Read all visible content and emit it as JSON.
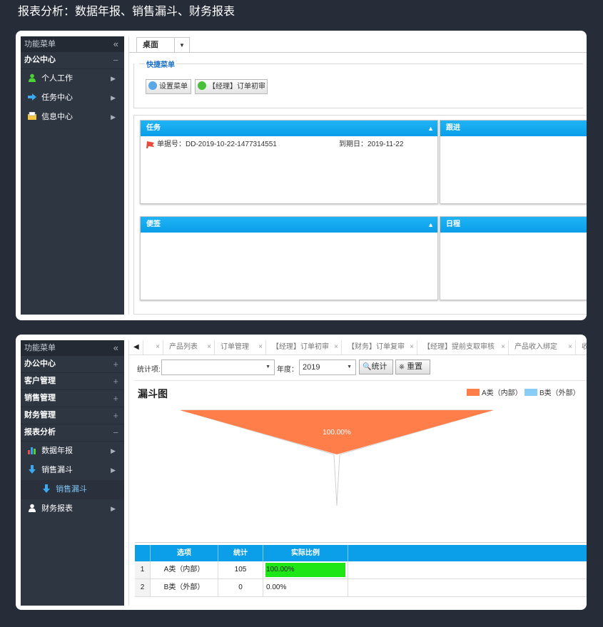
{
  "page_title": "报表分析：数据年报、销售漏斗、财务报表",
  "screen1": {
    "sidebar": {
      "header": "功能菜单",
      "collapse_glyph": "«",
      "group": {
        "label": "办公中心",
        "toggle": "−"
      },
      "items": [
        {
          "label": "个人工作",
          "icon": "user-icon"
        },
        {
          "label": "任务中心",
          "icon": "arrow-right-icon"
        },
        {
          "label": "信息中心",
          "icon": "message-icon"
        }
      ]
    },
    "tabs": {
      "desk": "桌面",
      "dropdown_glyph": "▼"
    },
    "quick_menu": {
      "legend": "快捷菜单",
      "buttons": [
        {
          "label": "设置菜单"
        },
        {
          "label": "【经理】订单初审"
        }
      ]
    },
    "panels": {
      "task": {
        "title": "任务",
        "row": {
          "order_no": "单据号：DD-2019-10-22-1477314551",
          "due": "到期日：2019-11-22"
        }
      },
      "follow": {
        "title": "跟进"
      },
      "note": {
        "title": "便签"
      },
      "schedule": {
        "title": "日程"
      }
    }
  },
  "screen2": {
    "sidebar": {
      "header": "功能菜单",
      "collapse_glyph": "«",
      "groups": [
        {
          "label": "办公中心",
          "toggle": "+"
        },
        {
          "label": "客户管理",
          "toggle": "+"
        },
        {
          "label": "销售管理",
          "toggle": "+"
        },
        {
          "label": "财务管理",
          "toggle": "+"
        },
        {
          "label": "报表分析",
          "toggle": "−"
        }
      ],
      "items": [
        {
          "label": "数据年报",
          "icon": "bar-chart-icon"
        },
        {
          "label": "销售漏斗",
          "icon": "arrow-down-icon"
        }
      ],
      "sub_item": {
        "label": "销售漏斗",
        "icon": "arrow-down-icon"
      },
      "last_item": {
        "label": "财务报表",
        "icon": "user-icon"
      }
    },
    "tabs": [
      {
        "label": "产品列表"
      },
      {
        "label": "订单管理"
      },
      {
        "label": "【经理】订单初审"
      },
      {
        "label": "【财务】订单复审"
      },
      {
        "label": "【经理】提前支取审核"
      },
      {
        "label": "产品收入绑定"
      },
      {
        "label": "收"
      }
    ],
    "close_glyph": "×",
    "toolbar": {
      "stat_label": "统计项:",
      "stat_value": "",
      "year_label": "年度：",
      "year_value": "2019",
      "stat_button": "统计",
      "reset_button": "重置"
    },
    "colors": {
      "series_a": "#ff7e4a",
      "series_b": "#87cdf7",
      "header_blue": "#0a9fe8",
      "ratio_bar": "#1ee617"
    },
    "chart_data": {
      "type": "funnel",
      "title": "漏斗图",
      "legend_position": "top-right",
      "series": [
        {
          "name": "A类（内部）",
          "value": 105,
          "label": "100.00%",
          "color": "#ff7e4a"
        },
        {
          "name": "B类（外部）",
          "value": 0,
          "label": "0.00%",
          "color": "#87cdf7"
        }
      ]
    },
    "table": {
      "headers": [
        "选项",
        "统计",
        "实际比例"
      ],
      "rows": [
        {
          "index": "1",
          "option": "A类（内部）",
          "count": "105",
          "ratio": "100.00%",
          "ratio_value": 1.0
        },
        {
          "index": "2",
          "option": "B类（外部）",
          "count": "0",
          "ratio": "0.00%",
          "ratio_value": 0.0
        }
      ]
    }
  }
}
